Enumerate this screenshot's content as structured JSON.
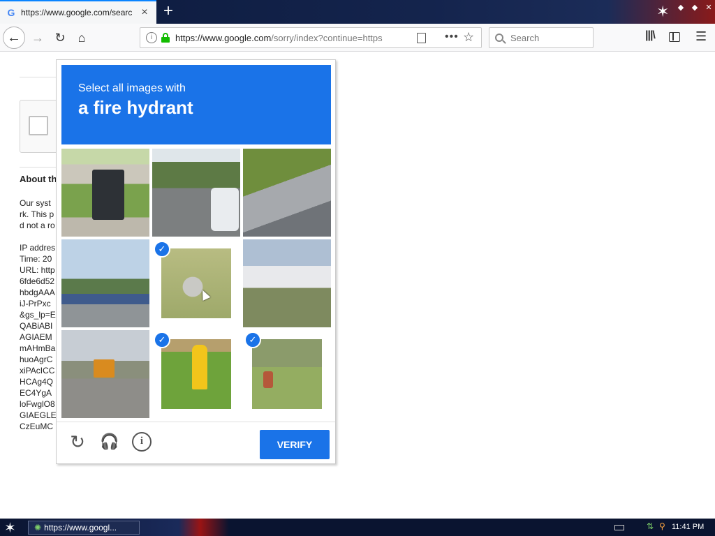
{
  "browser": {
    "tab": {
      "title": "https://www.google.com/search?",
      "favicon": "G"
    },
    "url": {
      "host": "https://www.google.com",
      "path": "/sorry/index?continue=https"
    },
    "search_placeholder": "Search"
  },
  "background_page": {
    "about_title": "About th",
    "lines": [
      "Our syst",
      "rk. This p",
      "d not a ro",
      "",
      "IP addres",
      "Time: 20",
      "URL: http",
      "6fde6d52",
      "hbdgAAA",
      "iJ-PrPxc",
      "&gs_lp=E",
      "QABiABI",
      "AGIAEM",
      "mAHmBa",
      "huoAgrC",
      "xiPAcICC",
      "HCAg4Q",
      "EC4YgA",
      "loFwglO8",
      "GIAEGLE",
      "CzEuMC"
    ]
  },
  "challenge": {
    "prompt": "Select all images with",
    "target": "a fire hydrant",
    "tiles": [
      {
        "selected": false
      },
      {
        "selected": false
      },
      {
        "selected": false
      },
      {
        "selected": false
      },
      {
        "selected": true
      },
      {
        "selected": false
      },
      {
        "selected": false
      },
      {
        "selected": true
      },
      {
        "selected": true
      }
    ],
    "verify_label": "VERIFY"
  },
  "taskbar": {
    "window_title": "https://www.googl...",
    "clock": "11:41 PM"
  },
  "colors": {
    "accent": "#1a73e8"
  }
}
